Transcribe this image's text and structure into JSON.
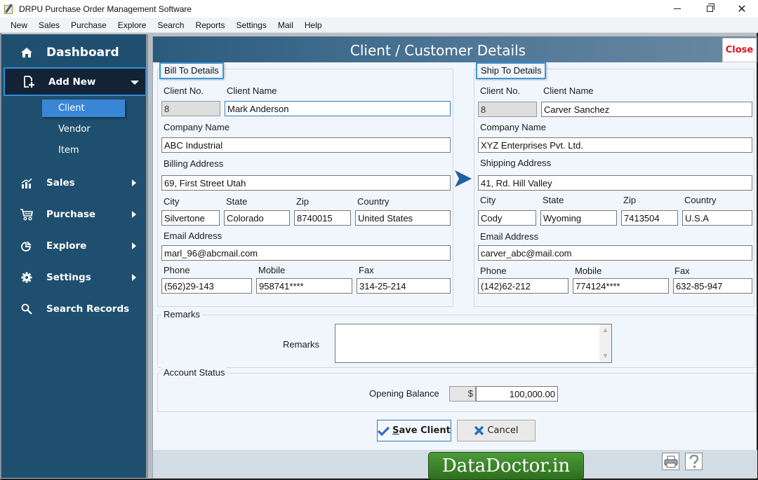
{
  "window": {
    "title": "DRPU Purchase Order Management Software",
    "controls": {
      "minimize": "minimize",
      "maximize": "restore",
      "close": "✕"
    }
  },
  "menubar": [
    "New",
    "Sales",
    "Purchase",
    "Explore",
    "Search",
    "Reports",
    "Settings",
    "Mail",
    "Help"
  ],
  "sidebar": {
    "dashboard": {
      "label": "Dashboard",
      "icon": "home-icon"
    },
    "add_new": {
      "label": "Add New",
      "icon": "add-document-icon",
      "expanded": true,
      "subitems": [
        {
          "label": "Client",
          "active": true
        },
        {
          "label": "Vendor",
          "active": false
        },
        {
          "label": "Item",
          "active": false
        }
      ]
    },
    "items": [
      {
        "label": "Sales",
        "icon": "chart-bars-icon",
        "has_submenu": true
      },
      {
        "label": "Purchase",
        "icon": "cart-icon",
        "has_submenu": true
      },
      {
        "label": "Explore",
        "icon": "pie-chart-icon",
        "has_submenu": true
      },
      {
        "label": "Settings",
        "icon": "gear-icon",
        "has_submenu": true
      },
      {
        "label": "Search Records",
        "icon": "search-icon",
        "has_submenu": false
      }
    ]
  },
  "main": {
    "title": "Client / Customer Details",
    "close_label": "Close",
    "bill_to": {
      "legend": "Bill To Details",
      "labels": {
        "client_no": "Client No.",
        "client_name": "Client Name",
        "company": "Company Name",
        "address": "Billing Address",
        "city": "City",
        "state": "State",
        "zip": "Zip",
        "country": "Country",
        "email": "Email Address",
        "phone": "Phone",
        "mobile": "Mobile",
        "fax": "Fax"
      },
      "values": {
        "client_no": "8",
        "client_name": "Mark Anderson",
        "company": "ABC Industrial",
        "address": "69, First Street Utah",
        "city": "Silvertone",
        "state": "Colorado",
        "zip": "8740015",
        "country": "United States",
        "email": "marl_96@abcmail.com",
        "phone": "(562)29-143",
        "mobile": "958741****",
        "fax": "314-25-214"
      }
    },
    "ship_to": {
      "legend": "Ship To Details",
      "labels": {
        "client_no": "Client No.",
        "client_name": "Client Name",
        "company": "Company Name",
        "address": "Shipping Address",
        "city": "City",
        "state": "State",
        "zip": "Zip",
        "country": "Country",
        "email": "Email Address",
        "phone": "Phone",
        "mobile": "Mobile",
        "fax": "Fax"
      },
      "values": {
        "client_no": "8",
        "client_name": "Carver Sanchez",
        "company": "XYZ Enterprises Pvt. Ltd.",
        "address": "41, Rd. Hill Valley",
        "city": "Cody",
        "state": "Wyoming",
        "zip": "7413504",
        "country": "U.S.A",
        "email": "carver_abc@mail.com",
        "phone": "(142)62-212",
        "mobile": "774124****",
        "fax": "632-85-947"
      }
    },
    "copy_arrow_icon": "arrow-right-icon",
    "remarks": {
      "legend": "Remarks",
      "label": "Remarks",
      "value": ""
    },
    "account_status": {
      "legend": "Account Status",
      "opening_balance_label": "Opening Balance",
      "currency_symbol": "$",
      "opening_balance": "100,000.00"
    },
    "buttons": {
      "save_first": "S",
      "save_rest": "ave Client",
      "cancel": "Cancel"
    }
  },
  "footer": {
    "brand": "DataDoctor.in",
    "icons": [
      "printer-icon",
      "help-icon"
    ]
  },
  "colors": {
    "sidebar_bg": "#1f4f6e",
    "sidebar_active": "#132235",
    "accent": "#3a86d6",
    "close_text": "#e0101a",
    "panel_bg": "#f1f6fd",
    "brand_green": "#3d8a2c"
  }
}
